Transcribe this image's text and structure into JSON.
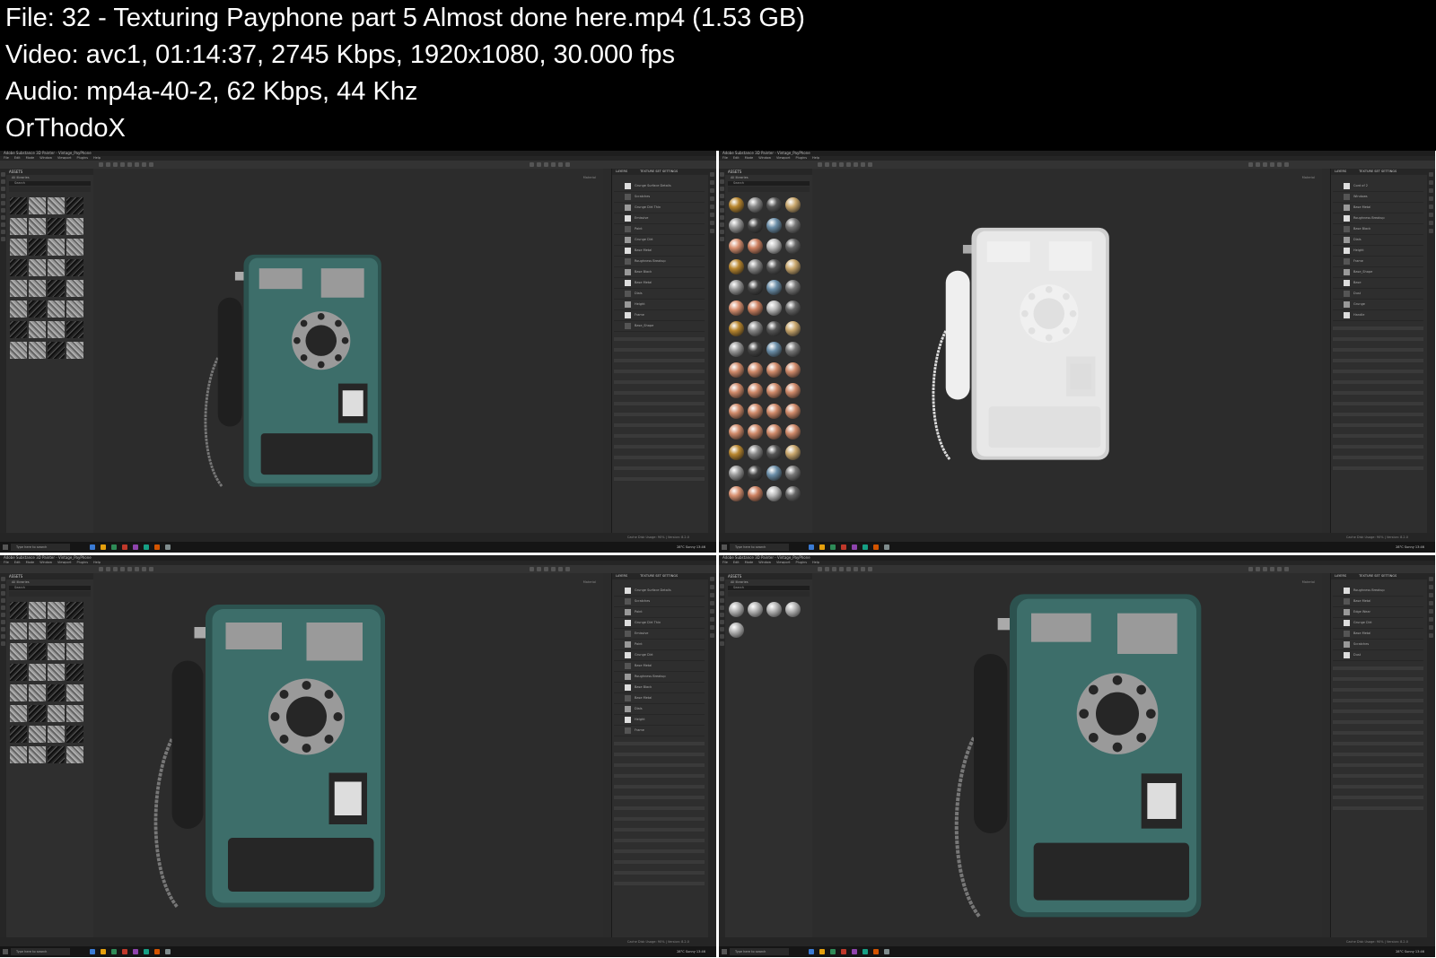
{
  "header": {
    "file_line": "File: 32 - Texturing Payphone part 5 Almost done here.mp4 (1.53 GB)",
    "video_line": "Video: avc1, 01:14:37, 2745 Kbps, 1920x1080, 30.000 fps",
    "audio_line": "Audio: mp4a-40-2, 62 Kbps, 44 Khz",
    "author_line": "OrThodoX"
  },
  "app": {
    "window_title": "Adobe Substance 3D Painter - Vintage_PayPhone",
    "menu": [
      "File",
      "Edit",
      "Mode",
      "Window",
      "Viewport",
      "Plugins",
      "Help"
    ],
    "assets_title": "ASSETS",
    "library_label": "All libraries",
    "search_placeholder": "Search",
    "layers_tab": "LAYERS",
    "texture_set_tab": "TEXTURE SET SETTINGS",
    "viewport_mode": "Material",
    "status_text": "Cache Disk Usage: 90% | Version: 8.2.0",
    "taskbar_search": "Type here to search",
    "weather": "28°C Sunny",
    "clock": "13:46"
  },
  "thumbs": [
    {
      "layers": [
        "Grunge Surface Details",
        "Scratches",
        "Grunge Dirt Thin",
        "Emissive",
        "Paint",
        "Grunge Dirt",
        "Base Metal",
        "Roughness Breakup",
        "Base Black",
        "Base Metal",
        "Dials",
        "Height",
        "Frame",
        "Base_Shape"
      ]
    },
    {
      "layers": [
        "Cord of 2",
        "Windows",
        "Base Metal",
        "Roughness Breakup",
        "Base Black",
        "Dials",
        "Height",
        "Frame",
        "Base_Shape",
        "Base",
        "Dust",
        "Grunge",
        "Handle"
      ]
    },
    {
      "layers": [
        "Grunge Surface Details",
        "Scratches",
        "Paint",
        "Grunge Dirt Thin",
        "Emissive",
        "Paint",
        "Grunge Dirt",
        "Base Metal",
        "Roughness Breakup",
        "Base Black",
        "Base Metal",
        "Dials",
        "Height",
        "Frame"
      ]
    },
    {
      "layers": [
        "Roughness Breakup",
        "Base Metal",
        "Edge Wear",
        "Grunge Dirt",
        "Base Metal",
        "Scratches",
        "Dust"
      ]
    }
  ]
}
